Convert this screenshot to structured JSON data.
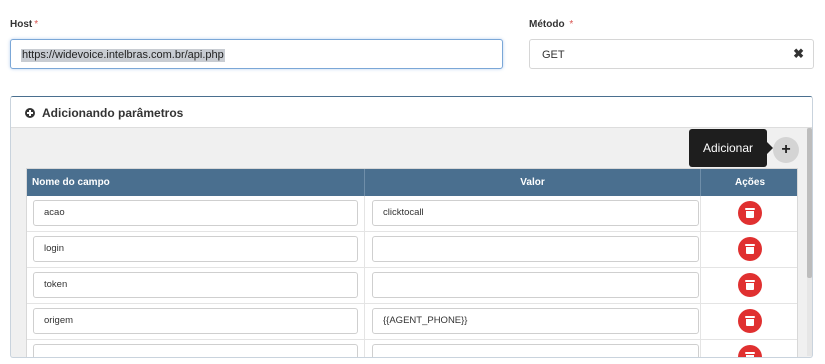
{
  "host": {
    "label": "Host",
    "required_mark": "*",
    "value": "https://widevoice.intelbras.com.br/api.php"
  },
  "method": {
    "label": "Método",
    "required_mark": "*",
    "value": "GET",
    "clear_icon": "✖"
  },
  "params_panel": {
    "toggle_icon": "plus-circle-icon",
    "title": "Adicionando parâmetros",
    "add_tooltip": "Adicionar",
    "add_icon": "+",
    "columns": [
      "Nome do campo",
      "Valor",
      "Ações"
    ],
    "rows": [
      {
        "name": "acao",
        "value": "clicktocall"
      },
      {
        "name": "login",
        "value": ""
      },
      {
        "name": "token",
        "value": ""
      },
      {
        "name": "origem",
        "value": "{{AGENT_PHONE}}"
      },
      {
        "name": "",
        "value": ""
      }
    ]
  },
  "colors": {
    "header_bg": "#4a6f8f",
    "delete_button": "#e03030",
    "required_mark": "#d9534f"
  }
}
